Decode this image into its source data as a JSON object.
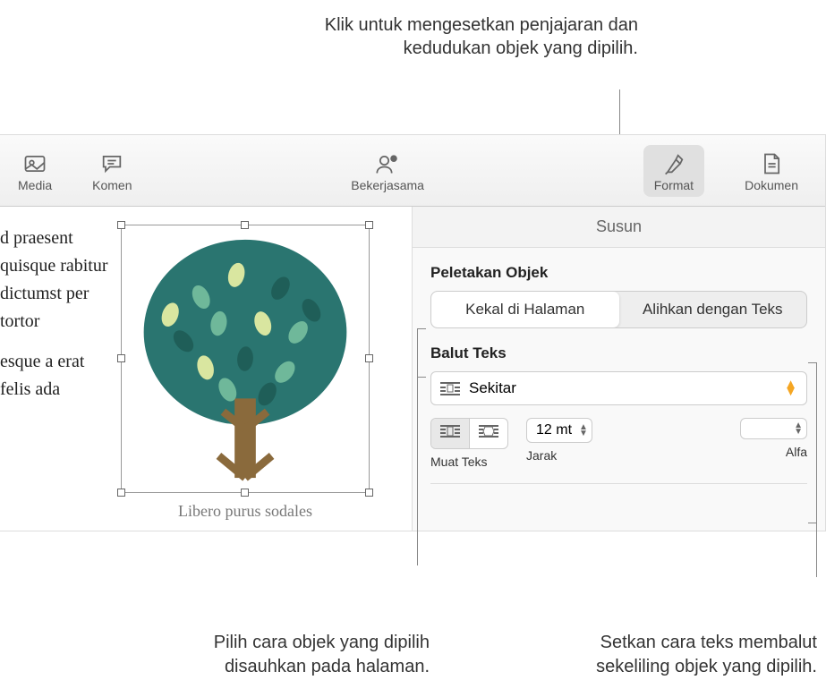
{
  "callouts": {
    "top": "Klik untuk mengesetkan penjajaran dan kedudukan objek yang dipilih.",
    "bottom_left": "Pilih cara objek yang dipilih disauhkan pada halaman.",
    "bottom_right": "Setkan cara teks membalut sekeliling objek yang dipilih."
  },
  "toolbar": {
    "media": "Media",
    "comment": "Komen",
    "collaborate": "Bekerjasama",
    "format": "Format",
    "document": "Dokumen"
  },
  "inspector": {
    "tab": "Susun",
    "object_placement": "Peletakan Objek",
    "stay_on_page": "Kekal di Halaman",
    "move_with_text": "Alihkan dengan Teks",
    "text_wrap": "Balut Teks",
    "wrap_value": "Sekitar",
    "fit_text": "Muat Teks",
    "spacing": "Jarak",
    "spacing_value": "12 mt",
    "alpha": "Alfa",
    "alpha_value": ""
  },
  "document": {
    "paragraph1": "d praesent  quisque rabitur dictumst per tortor",
    "paragraph2": "esque a erat felis ada",
    "caption": "Libero purus sodales"
  }
}
